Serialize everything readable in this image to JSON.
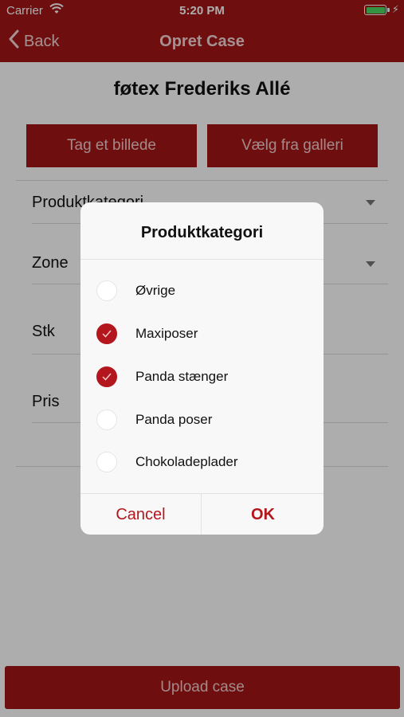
{
  "status_bar": {
    "carrier": "Carrier",
    "time": "5:20 PM",
    "battery_color": "#4cd964"
  },
  "nav": {
    "back_label": "Back",
    "title": "Opret Case",
    "background_color": "#a31515"
  },
  "store": {
    "name": "føtex Frederiks Allé"
  },
  "photo_buttons": {
    "take_photo": "Tag et billede",
    "from_gallery": "Vælg fra galleri"
  },
  "form": {
    "fields": [
      {
        "label": "Produktkategori",
        "type": "dropdown"
      },
      {
        "label": "Zone",
        "type": "dropdown"
      },
      {
        "label": "Stk",
        "type": "number"
      },
      {
        "label": "Pris",
        "type": "number"
      }
    ]
  },
  "upload_button": {
    "label": "Upload case"
  },
  "dialog": {
    "title": "Produktkategori",
    "options": [
      {
        "label": "Øvrige",
        "checked": false
      },
      {
        "label": "Maxiposer",
        "checked": true
      },
      {
        "label": "Panda stænger",
        "checked": true
      },
      {
        "label": "Panda poser",
        "checked": false
      },
      {
        "label": "Chokoladeplader",
        "checked": false
      }
    ],
    "cancel_label": "Cancel",
    "ok_label": "OK",
    "accent_color": "#b3161c"
  }
}
